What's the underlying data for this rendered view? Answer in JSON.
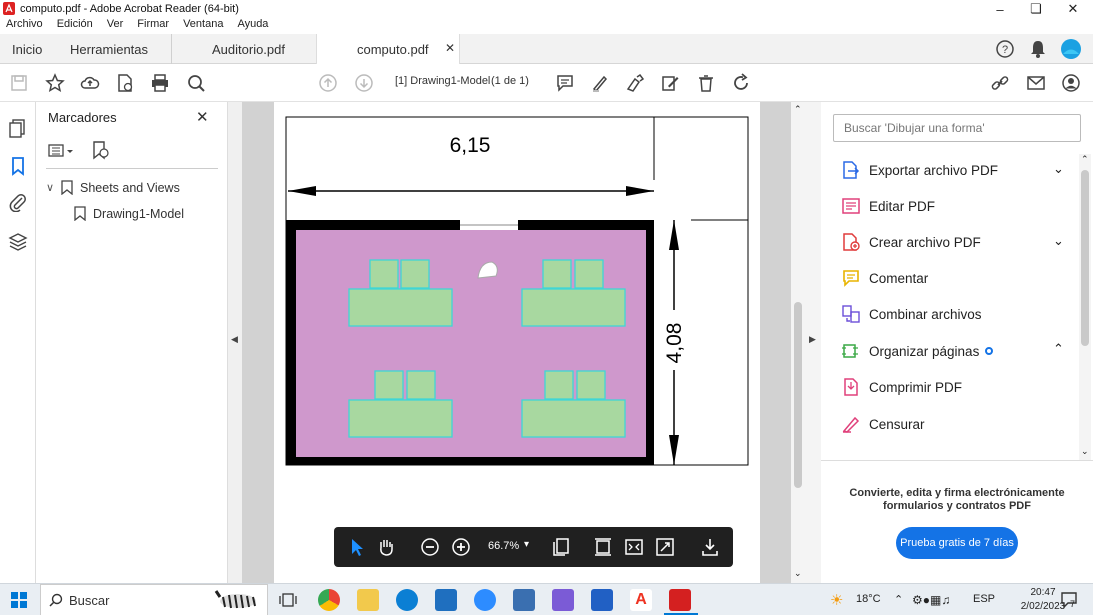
{
  "window": {
    "title": "computo.pdf - Adobe Acrobat Reader (64-bit)"
  },
  "menu": [
    "Archivo",
    "Edición",
    "Ver",
    "Firmar",
    "Ventana",
    "Ayuda"
  ],
  "tabs": {
    "home": "Inicio",
    "tools": "Herramientas",
    "doc1": "Auditorio.pdf",
    "doc2": "computo.pdf"
  },
  "toolbar": {
    "page_label": "[1] Drawing1-Model",
    "page_count": "(1 de 1)"
  },
  "bookmarks": {
    "title": "Marcadores",
    "items": [
      {
        "label": "Sheets and Views"
      },
      {
        "label": "Drawing1-Model"
      }
    ]
  },
  "drawing": {
    "width_label": "6,15",
    "height_label": "4,08"
  },
  "right_panel": {
    "search_placeholder": "Buscar 'Dibujar una forma'",
    "tools": [
      {
        "label": "Exportar archivo PDF",
        "icon": "export-pdf-icon",
        "color": "#2b6ae6"
      },
      {
        "label": "Editar PDF",
        "icon": "edit-pdf-icon",
        "color": "#e0407b"
      },
      {
        "label": "Crear archivo PDF",
        "icon": "create-pdf-icon",
        "color": "#e03c3c"
      },
      {
        "label": "Comentar",
        "icon": "comment-icon",
        "color": "#e8b400"
      },
      {
        "label": "Combinar archivos",
        "icon": "combine-icon",
        "color": "#6b4fd8"
      },
      {
        "label": "Organizar páginas",
        "icon": "organize-icon",
        "color": "#3aa845"
      },
      {
        "label": "Comprimir PDF",
        "icon": "compress-icon",
        "color": "#e0407b"
      },
      {
        "label": "Censurar",
        "icon": "redact-icon",
        "color": "#e0407b"
      }
    ],
    "promo_text": "Convierte, edita y firma electrónicamente formularios y contratos PDF",
    "promo_button": "Prueba gratis de 7 días"
  },
  "float_toolbar": {
    "zoom": "66.7%"
  },
  "taskbar": {
    "search": "Buscar",
    "temperature": "18°C",
    "language": "ESP",
    "time": "20:47",
    "date": "2/02/2023",
    "notifications": "7"
  },
  "colors": {
    "accent": "#1473e6",
    "room_floor": "#cf98cc",
    "furniture": "#a8d8a0",
    "furniture_outline": "#3fd6d6",
    "taskbar": "#e9eef3"
  }
}
